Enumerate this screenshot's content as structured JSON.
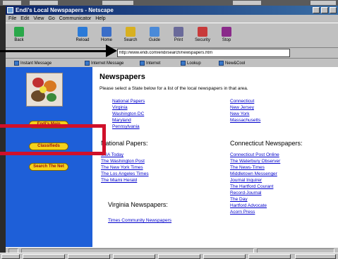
{
  "window": {
    "title": "Endi's Local Newspapers - Netscape"
  },
  "menu": [
    "File",
    "Edit",
    "View",
    "Go",
    "Communicator",
    "Help"
  ],
  "toolbar": {
    "buttons": [
      {
        "label": "Back",
        "color": "#2aa84a"
      },
      {
        "label": "Reload",
        "color": "#2a7ad8"
      },
      {
        "label": "Home",
        "color": "#3a6ec8"
      },
      {
        "label": "Search",
        "color": "#d8b020"
      },
      {
        "label": "Guide",
        "color": "#4a8ad8"
      },
      {
        "label": "Print",
        "color": "#6a6a9a"
      },
      {
        "label": "Security",
        "color": "#c83a3a"
      },
      {
        "label": "Stop",
        "color": "#8a2a8a"
      }
    ]
  },
  "location": {
    "url": "http://www.endi.com/endi/search/newspapers.htm"
  },
  "linkbar": {
    "items": [
      "Instant Message",
      "Internet Message",
      "Internet",
      "Lookup",
      "New&Cool"
    ]
  },
  "sidebar": {
    "buttons": [
      "Endi's Main",
      "Classifieds",
      "Search The Net"
    ]
  },
  "main": {
    "heading": "Newspapers",
    "intro": "Please select a State below for a list of the local newspapers in that area.",
    "states_left": [
      "National Papers",
      "Virginia",
      "Washington DC",
      "Maryland",
      "Pennsylvania"
    ],
    "states_right": [
      "Connecticut",
      "New Jersey",
      "New York",
      "Massachusetts"
    ],
    "national_heading": "National Papers:",
    "national_papers": [
      "USA Today",
      "The Washington Post",
      "The New York Times",
      "The Los Angeles Times",
      "The Miami Herald"
    ],
    "connecticut_heading": "Connecticut Newspapers:",
    "connecticut_papers": [
      "Connecticut Post Online",
      "The Waterbury Observer",
      "The News-Times",
      "Middletown Messenger",
      "Journal Inquirer",
      "The Hartford Courant",
      "Record-Journal",
      "The Day",
      "Hartford Advocate",
      "Acorn Press"
    ],
    "virginia_heading": "Virginia Newspapers:",
    "virginia_papers": [
      "Times Community Newspapers"
    ]
  },
  "colors": {
    "sidebar": "#1e5fd8",
    "button": "#f4d21c",
    "link": "#0000cc",
    "annotation": "#d0102a"
  }
}
